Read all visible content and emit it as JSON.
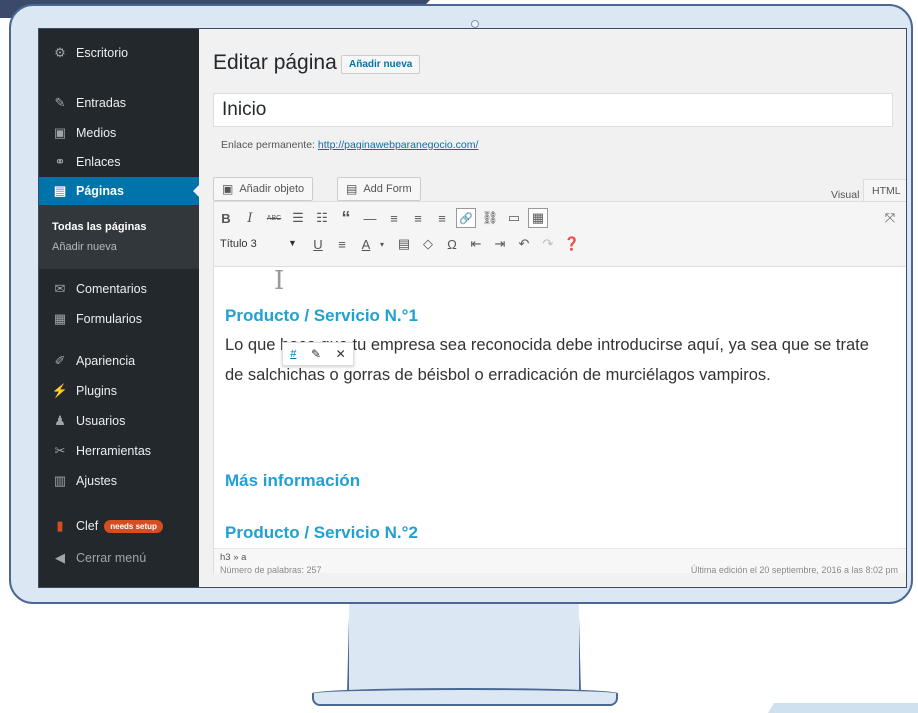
{
  "sidebar": {
    "items": [
      {
        "label": "Escritorio",
        "icon": "dashboard-icon",
        "glyph": "⚙"
      },
      {
        "label": "Entradas",
        "icon": "pin-icon",
        "glyph": "✎"
      },
      {
        "label": "Medios",
        "icon": "media-icon",
        "glyph": "▣"
      },
      {
        "label": "Enlaces",
        "icon": "link-icon",
        "glyph": "⚭"
      },
      {
        "label": "Páginas",
        "icon": "pages-icon",
        "glyph": "▤"
      },
      {
        "label": "Comentarios",
        "icon": "comments-icon",
        "glyph": "✉"
      },
      {
        "label": "Formularios",
        "icon": "forms-icon",
        "glyph": "▦"
      },
      {
        "label": "Apariencia",
        "icon": "appearance-icon",
        "glyph": "✐"
      },
      {
        "label": "Plugins",
        "icon": "plugins-icon",
        "glyph": "⚡"
      },
      {
        "label": "Usuarios",
        "icon": "users-icon",
        "glyph": "♟"
      },
      {
        "label": "Herramientas",
        "icon": "tools-icon",
        "glyph": "✂"
      },
      {
        "label": "Ajustes",
        "icon": "settings-icon",
        "glyph": "▥"
      },
      {
        "label": "Clef",
        "icon": "clef-icon",
        "glyph": "▮",
        "badge": "needs setup"
      },
      {
        "label": "Cerrar menú",
        "icon": "collapse-icon",
        "glyph": "◀"
      }
    ],
    "submenu": [
      "Todas las páginas",
      "Añadir nueva"
    ]
  },
  "header": {
    "title": "Editar página",
    "add_new": "Añadir nueva"
  },
  "post_title": "Inicio",
  "permalink": {
    "label": "Enlace permanente:",
    "url": "http://paginawebparanegocio.com/"
  },
  "media_buttons": {
    "add_object": "Añadir objeto",
    "add_form": "Add Form"
  },
  "editor_tabs": {
    "visual": "Visual",
    "html": "HTML"
  },
  "toolbar": {
    "format": "Título 3",
    "row1": [
      "B",
      "I",
      "ABC",
      "☰",
      "☷",
      "“",
      "—",
      "≡",
      "≡",
      "≡",
      "🔗",
      "⛓",
      "▭",
      "▦"
    ],
    "row2": [
      "U",
      "≡",
      "A",
      "▾",
      "▤",
      "◇",
      "Ω",
      "⇤",
      "⇥",
      "↶",
      "↷",
      "❓"
    ]
  },
  "content": {
    "heading1": "Producto / Servicio N.°1",
    "paragraph": "Lo que hace que tu empresa sea reconocida debe introducirse aquí, ya sea que se trate de salchichas o gorras de béisbol o erradicación de murciélagos vampiros.",
    "heading2": "Más información",
    "heading3": "Producto / Servicio N.°2"
  },
  "link_toolbar": {
    "hash": "#",
    "edit_icon": "pencil-icon",
    "close_icon": "close-icon"
  },
  "status": {
    "path": "h3 » a",
    "word_count": "Número de palabras: 257",
    "last_edit": "Última edición el 20 septiembre, 2016 a las 8:02 pm"
  }
}
